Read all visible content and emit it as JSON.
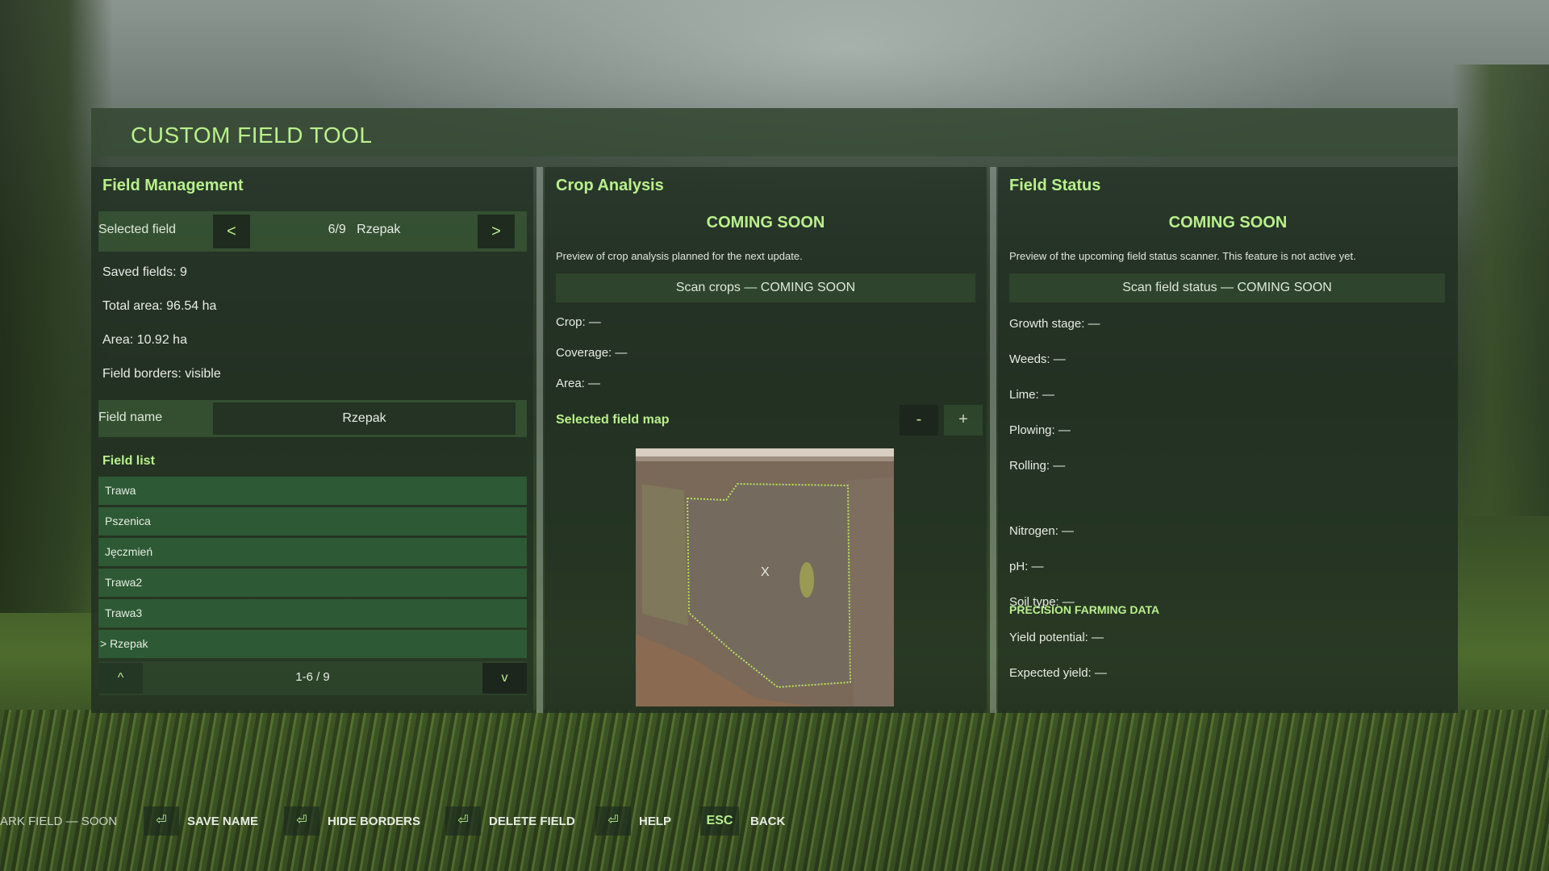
{
  "window": {
    "title": "CUSTOM FIELD TOOL"
  },
  "colors": {
    "accent": "#b9f08c",
    "panel_bg": "#1e2c20",
    "list_item_bg": "#30643a",
    "button_dark": "#1f2b1f"
  },
  "field_management": {
    "title": "Field Management",
    "selected_field_label": "Selected field",
    "prev_label": "<",
    "next_label": ">",
    "selected_field_value": "6/9   Rzepak",
    "saved_fields": "Saved fields: 9",
    "total_area": "Total area: 96.54 ha",
    "area": "Area: 10.92 ha",
    "field_borders": "Field borders: visible",
    "field_name_label": "Field name",
    "field_name_value": "Rzepak",
    "field_list_title": "Field list",
    "field_list": [
      "Trawa",
      "Pszenica",
      "Jęczmień",
      "Trawa2",
      "Trawa3",
      "> Rzepak"
    ],
    "pager_up": "^",
    "pager_down": "v",
    "pager_text": "1-6 / 9"
  },
  "crop_analysis": {
    "title": "Crop Analysis",
    "coming_soon": "COMING SOON",
    "preview_text": "Preview of crop analysis planned for the next update.",
    "scan_button": "Scan crops — COMING SOON",
    "crop": "Crop: —",
    "coverage": "Coverage: —",
    "area": "Area: —",
    "map_title": "Selected field map",
    "zoom_out": "-",
    "zoom_in": "+",
    "map_marker": "X"
  },
  "field_status": {
    "title": "Field Status",
    "coming_soon": "COMING SOON",
    "preview_text": "Preview of the upcoming field status scanner. This feature is not active yet.",
    "scan_button": "Scan field status — COMING SOON",
    "growth_stage": "Growth stage: —",
    "weeds": "Weeds: —",
    "lime": "Lime: —",
    "plowing": "Plowing: —",
    "rolling": "Rolling: —",
    "precision_title": "PRECISION FARMING DATA",
    "nitrogen": "Nitrogen: —",
    "ph": "pH: —",
    "soil_type": "Soil type: —",
    "yield_potential": "Yield potential: —",
    "expected_yield": "Expected yield: —"
  },
  "bottom_hints": {
    "mark_field": "ARK FIELD — SOON",
    "save_name": "SAVE NAME",
    "hide_borders": "HIDE BORDERS",
    "delete_field": "DELETE FIELD",
    "help": "HELP",
    "esc_key": "ESC",
    "back": "BACK",
    "key_icon_name": "enter-key-icon"
  }
}
